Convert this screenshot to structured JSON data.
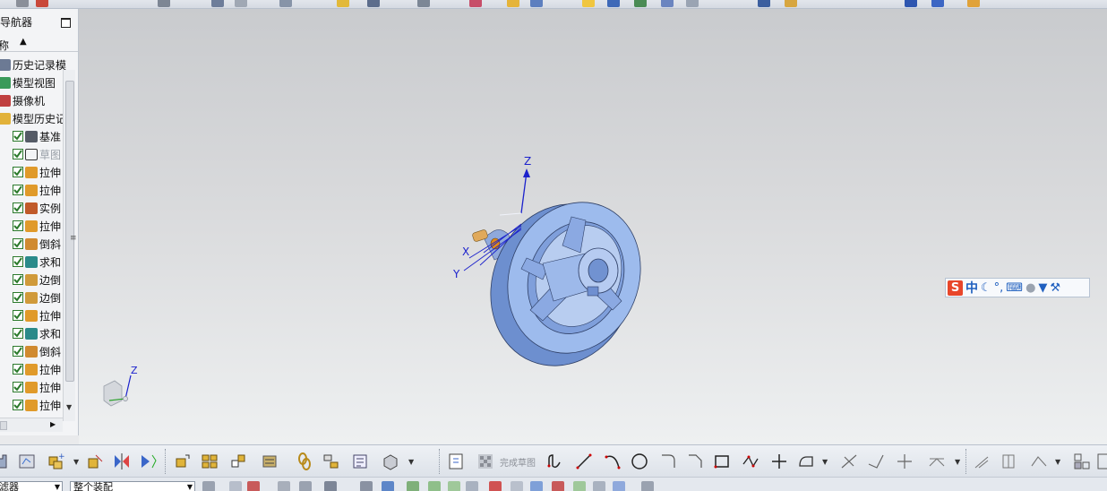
{
  "navigator": {
    "title": "导航器",
    "column_label": "称",
    "sort_indicator": "▲",
    "tree": [
      {
        "label": "历史记录模",
        "icon": "clock-icon",
        "checked": false
      },
      {
        "label": "模型视图",
        "icon": "model-view-icon",
        "checked": false
      },
      {
        "label": "摄像机",
        "icon": "camera-icon",
        "checked": false
      },
      {
        "label": "模型历史记",
        "icon": "folder-open-icon",
        "checked": false
      },
      {
        "label": "基准",
        "icon": "datum-csys-icon",
        "checked": true
      },
      {
        "label": "草图",
        "icon": "sketch-icon",
        "checked": true,
        "dimmed": true
      },
      {
        "label": "拉伸",
        "icon": "extrude-icon",
        "checked": true
      },
      {
        "label": "拉伸",
        "icon": "extrude-icon",
        "checked": true
      },
      {
        "label": "实例",
        "icon": "pattern-icon",
        "checked": true
      },
      {
        "label": "拉伸",
        "icon": "extrude-icon",
        "checked": true
      },
      {
        "label": "倒斜",
        "icon": "chamfer-icon",
        "checked": true
      },
      {
        "label": "求和",
        "icon": "unite-icon",
        "checked": true
      },
      {
        "label": "边倒",
        "icon": "edge-blend-icon",
        "checked": true
      },
      {
        "label": "边倒",
        "icon": "edge-blend-icon",
        "checked": true
      },
      {
        "label": "拉伸",
        "icon": "extrude-icon",
        "checked": true
      },
      {
        "label": "求和",
        "icon": "unite-icon",
        "checked": true
      },
      {
        "label": "倒斜",
        "icon": "chamfer-icon",
        "checked": true
      },
      {
        "label": "拉伸",
        "icon": "extrude-icon",
        "checked": true
      },
      {
        "label": "拉伸",
        "icon": "extrude-icon",
        "checked": true
      },
      {
        "label": "拉伸",
        "icon": "extrude-icon",
        "checked": true
      }
    ]
  },
  "viewport": {
    "csys_labels": {
      "z": "Z",
      "x": "X",
      "y": "Y"
    },
    "triad_label": "Z"
  },
  "ime": {
    "logo": "S",
    "lang": "中"
  },
  "bottom_toolbar": {
    "finish_sketch": "完成草图"
  },
  "selection_bar": {
    "filter": "滤器",
    "assembly_scope": "整个装配"
  },
  "colors": {
    "model_fill": "#9bb8ea",
    "model_shadow": "#6b8fd0",
    "viewport_top": "#c9cbce",
    "viewport_bottom": "#eef0f1",
    "check_green": "#2c7a2c",
    "axis_blue": "#1c22cc"
  }
}
